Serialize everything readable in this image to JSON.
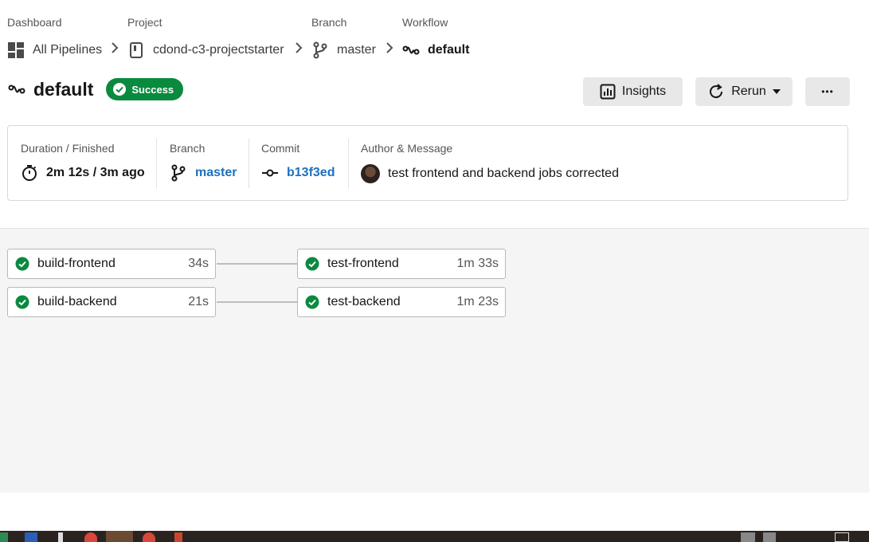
{
  "breadcrumb": {
    "dashboard": {
      "label": "Dashboard",
      "value": "All Pipelines",
      "icon": "dashboard-grid-icon"
    },
    "project": {
      "label": "Project",
      "value": "cdond-c3-projectstarter",
      "icon": "repository-icon"
    },
    "branch": {
      "label": "Branch",
      "value": "master",
      "icon": "branch-icon"
    },
    "workflow": {
      "label": "Workflow",
      "value": "default",
      "icon": "workflow-icon"
    }
  },
  "header": {
    "title": "default",
    "status": "Success",
    "insights_label": "Insights",
    "rerun_label": "Rerun",
    "more_label": "•••"
  },
  "summary": {
    "duration": {
      "label": "Duration / Finished",
      "value": "2m 12s / 3m ago"
    },
    "branch": {
      "label": "Branch",
      "value": "master"
    },
    "commit": {
      "label": "Commit",
      "value": "b13f3ed"
    },
    "author": {
      "label": "Author & Message",
      "message": "test frontend and backend jobs corrected"
    }
  },
  "jobs": [
    {
      "name": "build-frontend",
      "duration": "34s",
      "status": "success"
    },
    {
      "name": "test-frontend",
      "duration": "1m 33s",
      "status": "success"
    },
    {
      "name": "build-backend",
      "duration": "21s",
      "status": "success"
    },
    {
      "name": "test-backend",
      "duration": "1m 23s",
      "status": "success"
    }
  ],
  "colors": {
    "success": "#0a8a3f",
    "link": "#1d6fbd",
    "canvas": "#f5f5f5"
  }
}
